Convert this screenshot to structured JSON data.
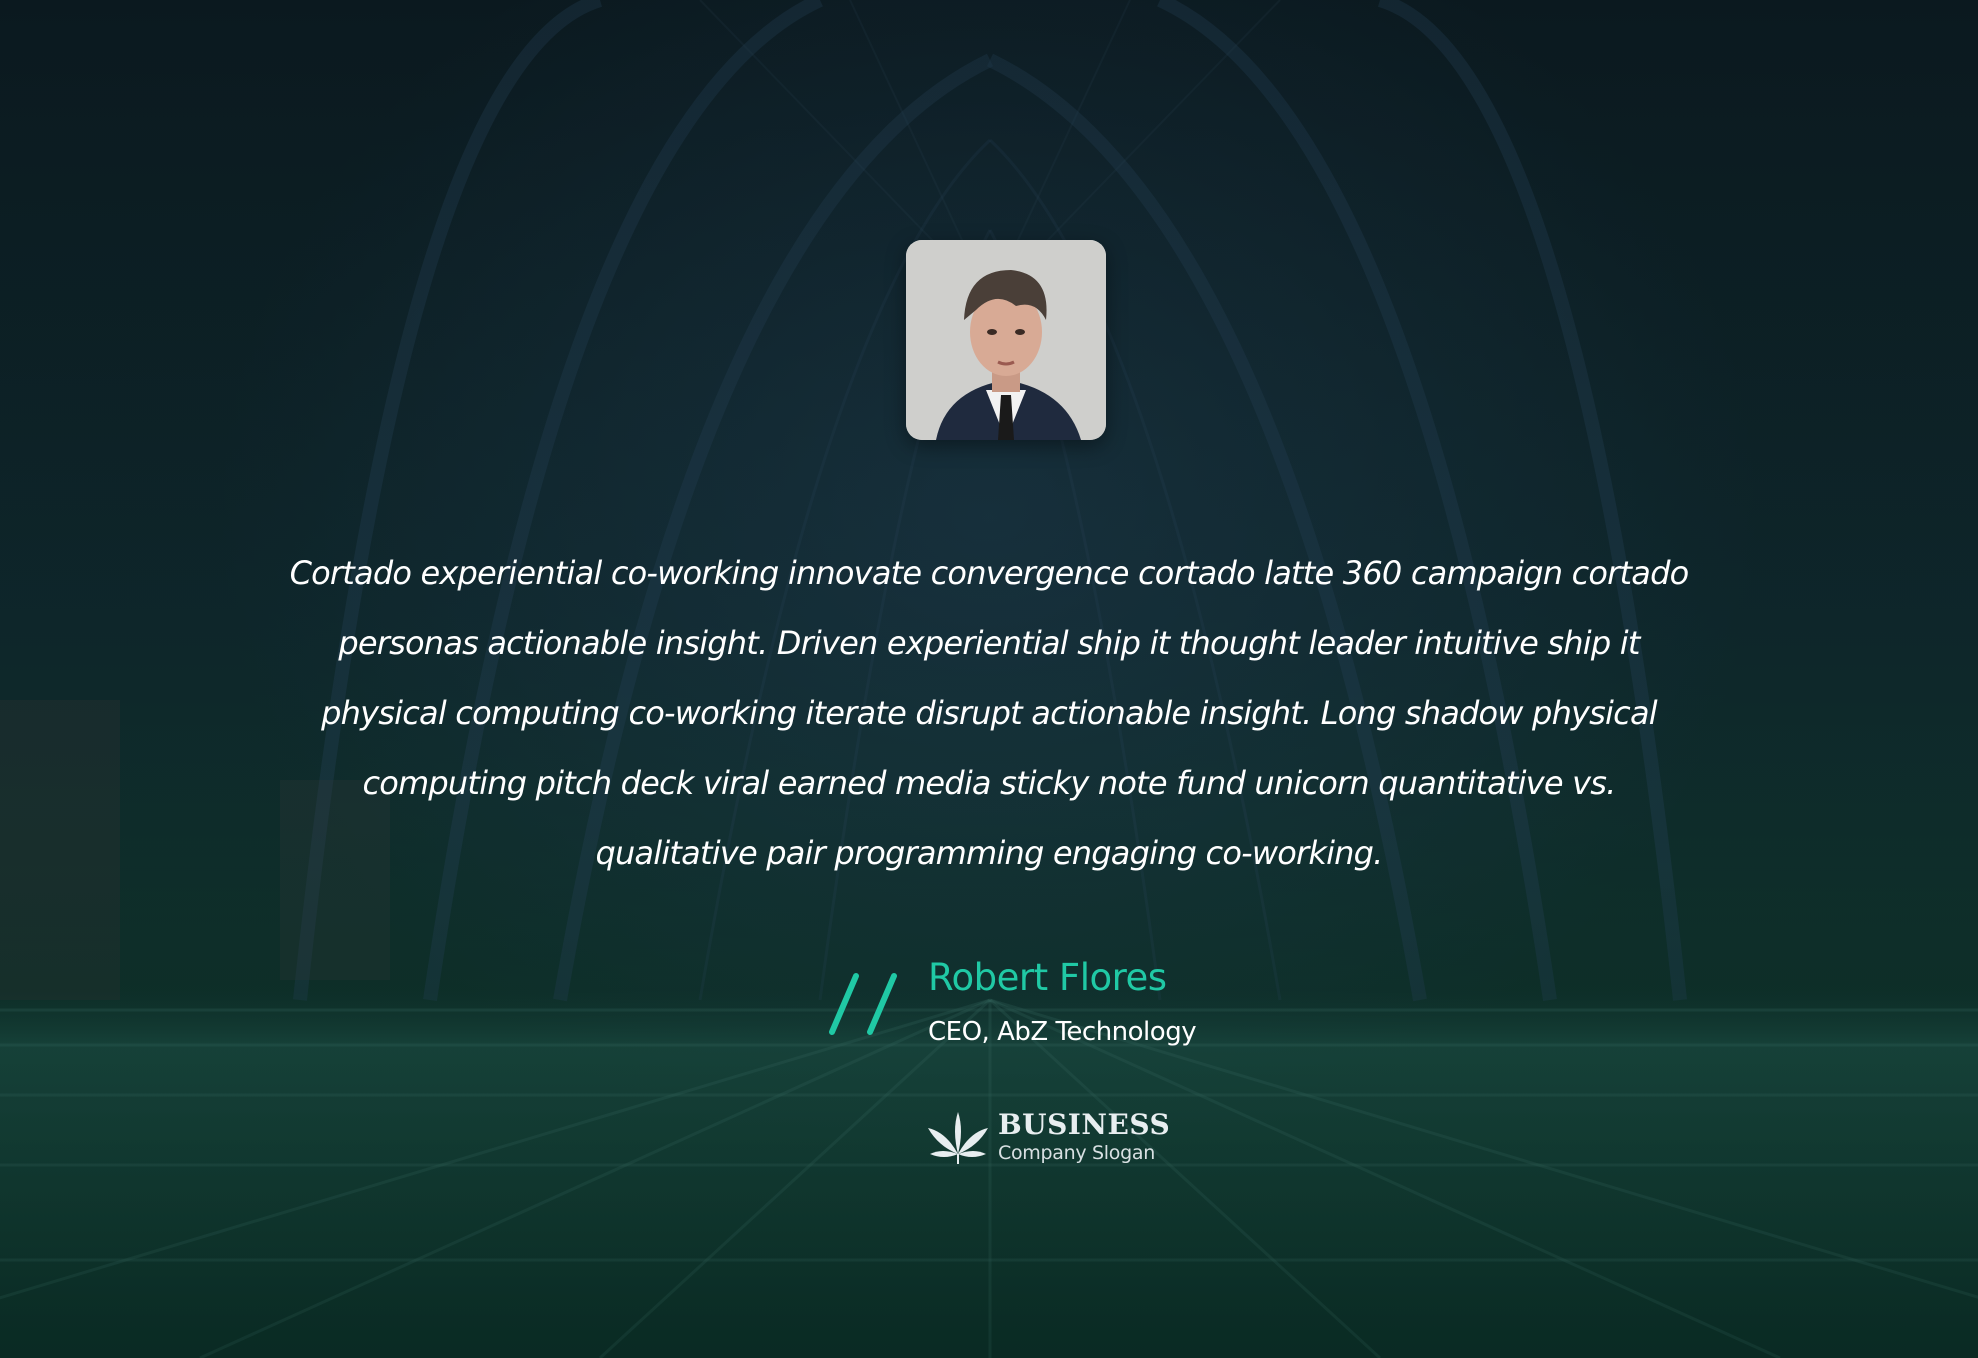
{
  "testimonial": {
    "quote": "Cortado experiential co-working innovate convergence cortado latte 360 campaign cortado personas actionable insight. Driven experiential ship it thought leader intuitive ship it physical computing co-working iterate disrupt actionable insight. Long shadow physical computing pitch deck viral earned media sticky note fund unicorn quantitative vs. qualitative pair programming engaging co-working.",
    "author_name": "Robert Flores",
    "author_role": "CEO, AbZ Technology"
  },
  "brand": {
    "name": "BUSINESS",
    "slogan": "Company Slogan",
    "icon": "cannabis-leaf-icon"
  },
  "colors": {
    "accent": "#20c9a5",
    "text": "#ffffff",
    "background": "#0f2a2c"
  }
}
